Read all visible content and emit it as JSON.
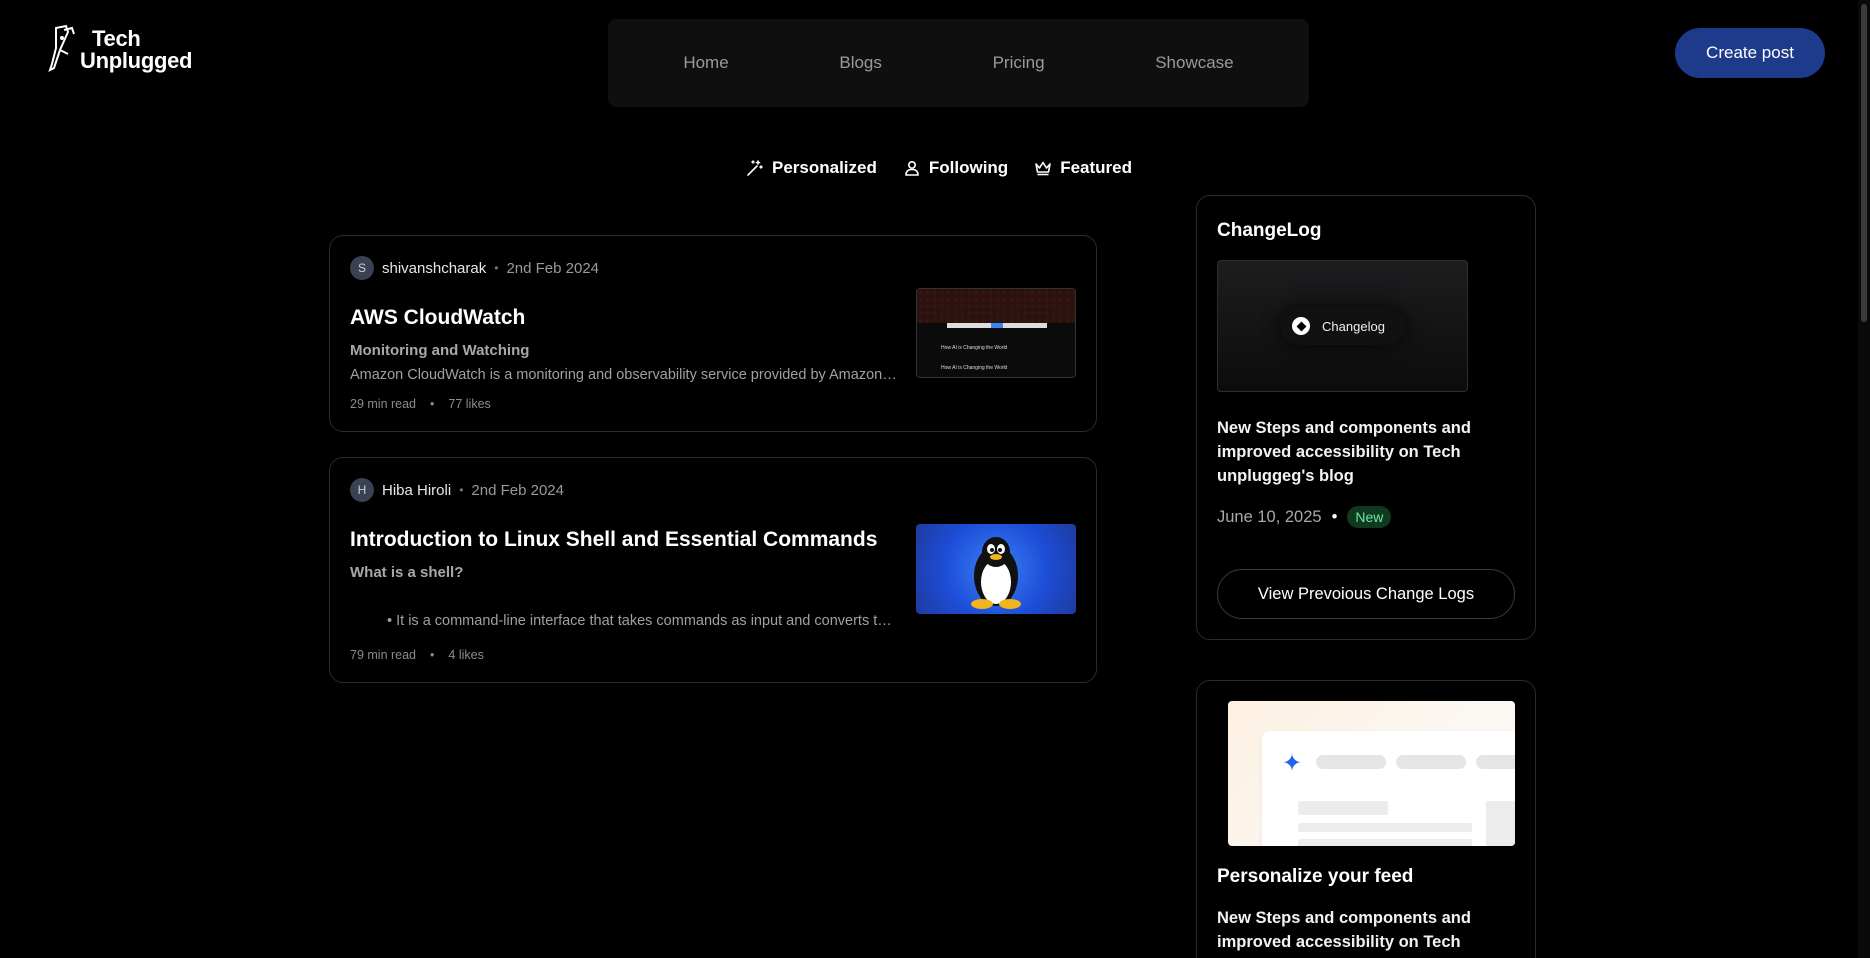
{
  "brand": {
    "line1": "Tech",
    "line2": "Unplugged"
  },
  "nav": {
    "items": [
      "Home",
      "Blogs",
      "Pricing",
      "Showcase"
    ]
  },
  "header": {
    "create_label": "Create post"
  },
  "feed_tabs": {
    "personalized": "Personalized",
    "following": "Following",
    "featured": "Featured"
  },
  "posts": [
    {
      "avatar_letter": "S",
      "author": "shivanshcharak",
      "date": "2nd Feb 2024",
      "title": "AWS CloudWatch",
      "subtitle": "Monitoring and Watching",
      "excerpt": "Amazon CloudWatch is a monitoring and observability service provided by Amazon Web Services",
      "read_time": "29 min read",
      "likes": "77 likes",
      "thumb_text": "How AI is Changing the World"
    },
    {
      "avatar_letter": "H",
      "author": "Hiba Hiroli",
      "date": "2nd Feb 2024",
      "title": "Introduction to Linux Shell and Essential Commands",
      "subtitle": "What is a shell?",
      "excerpt": "It is a command-line interface that takes commands as input and converts them",
      "read_time": "79 min read",
      "likes": "4 likes"
    }
  ],
  "changelog": {
    "title": "ChangeLog",
    "pill_label": "Changelog",
    "description": "New Steps and components and improved accessibility on Tech unpluggeg's blog",
    "date": "June 10, 2025",
    "badge": "New",
    "button_label": "View Prevoious Change Logs"
  },
  "personalize": {
    "title": "Personalize your feed",
    "description": "New Steps and components and improved accessibility on Tech"
  },
  "colors": {
    "background": "#000000",
    "accent": "#1e3a8a",
    "badge_bg": "#0f3a20",
    "badge_text": "#6ee7a1"
  }
}
